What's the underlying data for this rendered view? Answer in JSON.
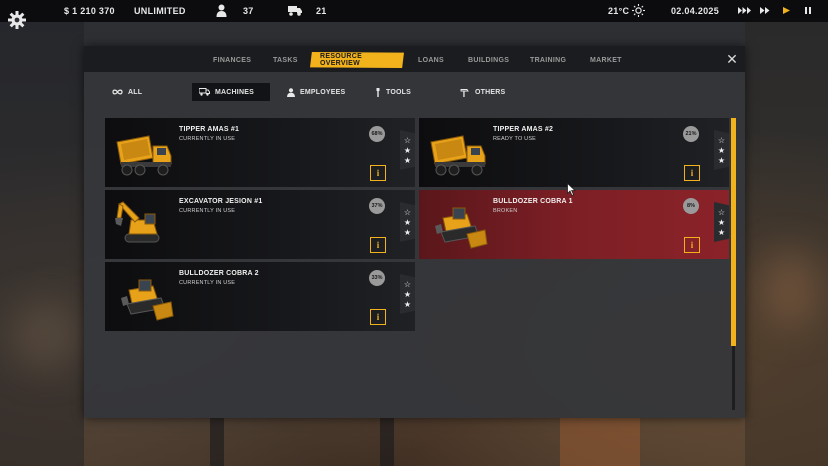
{
  "topbar": {
    "money": "$ 1 210 370",
    "limit": "UNLIMITED",
    "workers": "37",
    "vehicles": "21",
    "temperature": "21°C",
    "date": "02.04.2025",
    "weather_icon": "sun-icon",
    "speed_controls": [
      "fast-forward-icon",
      "fast-forward-icon",
      "play-icon",
      "pause-icon"
    ]
  },
  "tabs": [
    {
      "label": "FINANCES",
      "active": false
    },
    {
      "label": "TASKS",
      "active": false
    },
    {
      "label": "RESOURCE OVERVIEW",
      "active": true
    },
    {
      "label": "LOANS",
      "active": false
    },
    {
      "label": "BUILDINGS",
      "active": false
    },
    {
      "label": "TRAINING",
      "active": false
    },
    {
      "label": "MARKET",
      "active": false
    }
  ],
  "filters": [
    {
      "label": "ALL",
      "icon": "infinity-icon",
      "active": false
    },
    {
      "label": "MACHINES",
      "icon": "truck-icon",
      "active": true
    },
    {
      "label": "EMPLOYEES",
      "icon": "person-icon",
      "active": false
    },
    {
      "label": "TOOLS",
      "icon": "tool-icon",
      "active": false
    },
    {
      "label": "OTHERS",
      "icon": "hammer-icon",
      "active": false
    }
  ],
  "machines": [
    {
      "name": "TIPPER AMAS #1",
      "status": "CURRENTLY IN USE",
      "condition": "68%",
      "stars": [
        "☆",
        "★",
        "★"
      ],
      "type": "tipper",
      "broken": false
    },
    {
      "name": "TIPPER AMAS #2",
      "status": "READY TO USE",
      "condition": "21%",
      "stars": [
        "☆",
        "★",
        "★"
      ],
      "type": "tipper",
      "broken": false
    },
    {
      "name": "EXCAVATOR JESION #1",
      "status": "CURRENTLY IN USE",
      "condition": "37%",
      "stars": [
        "☆",
        "★",
        "★"
      ],
      "type": "excavator",
      "broken": false
    },
    {
      "name": "BULLDOZER COBRA 1",
      "status": "BROKEN",
      "condition": "8%",
      "stars": [
        "☆",
        "★",
        "★"
      ],
      "type": "bulldozer",
      "broken": true
    },
    {
      "name": "BULLDOZER COBRA 2",
      "status": "CURRENTLY IN USE",
      "condition": "33%",
      "stars": [
        "☆",
        "★",
        "★"
      ],
      "type": "bulldozer",
      "broken": false
    }
  ],
  "info_label": "i",
  "close_label": "✕",
  "colors": {
    "accent": "#f2b21c",
    "broken": "#7d1f25",
    "panel": "#34363a"
  }
}
